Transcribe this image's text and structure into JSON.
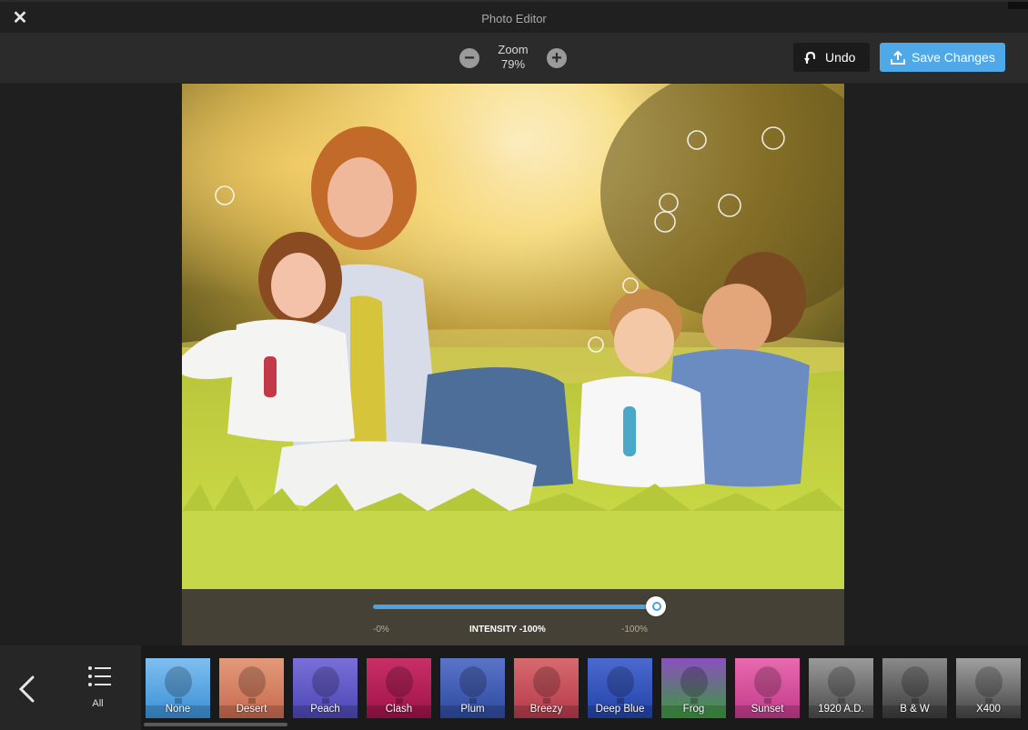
{
  "window": {
    "title": "Photo Editor",
    "close_icon": "close-icon"
  },
  "toolbar": {
    "zoom_label": "Zoom",
    "zoom_value": "79%",
    "undo_label": "Undo",
    "save_label": "Save Changes"
  },
  "intensity": {
    "min_label": "-0%",
    "label": "INTENSITY -100%",
    "max_label": "-100%",
    "value_fraction": 1.0
  },
  "bottom": {
    "all_label": "All",
    "filters": [
      {
        "label": "None",
        "colors": [
          "#3a8fd6",
          "#7fbff0"
        ]
      },
      {
        "label": "Desert",
        "colors": [
          "#c8694e",
          "#e39a7a"
        ]
      },
      {
        "label": "Peach",
        "colors": [
          "#4b47b5",
          "#7a6fd8"
        ]
      },
      {
        "label": "Clash",
        "colors": [
          "#a0124a",
          "#c83066"
        ]
      },
      {
        "label": "Plum",
        "colors": [
          "#2d4aa0",
          "#5a74c8"
        ]
      },
      {
        "label": "Breezy",
        "colors": [
          "#b53a4a",
          "#d86a6f"
        ]
      },
      {
        "label": "Deep Blue",
        "colors": [
          "#2343a8",
          "#4a6ad0"
        ]
      },
      {
        "label": "Frog",
        "colors": [
          "#3a9a3a",
          "#8a50c0"
        ]
      },
      {
        "label": "Sunset",
        "colors": [
          "#c23a8a",
          "#e86ab0"
        ]
      },
      {
        "label": "1920 A.D.",
        "colors": [
          "#4a4a4a",
          "#9a9a9a"
        ]
      },
      {
        "label": "B & W",
        "colors": [
          "#3a3a3a",
          "#8a8a8a"
        ]
      },
      {
        "label": "X400",
        "colors": [
          "#444444",
          "#a0a0a0"
        ]
      }
    ]
  },
  "colors": {
    "accent": "#4fa8e8",
    "track": "#4ba3df"
  }
}
